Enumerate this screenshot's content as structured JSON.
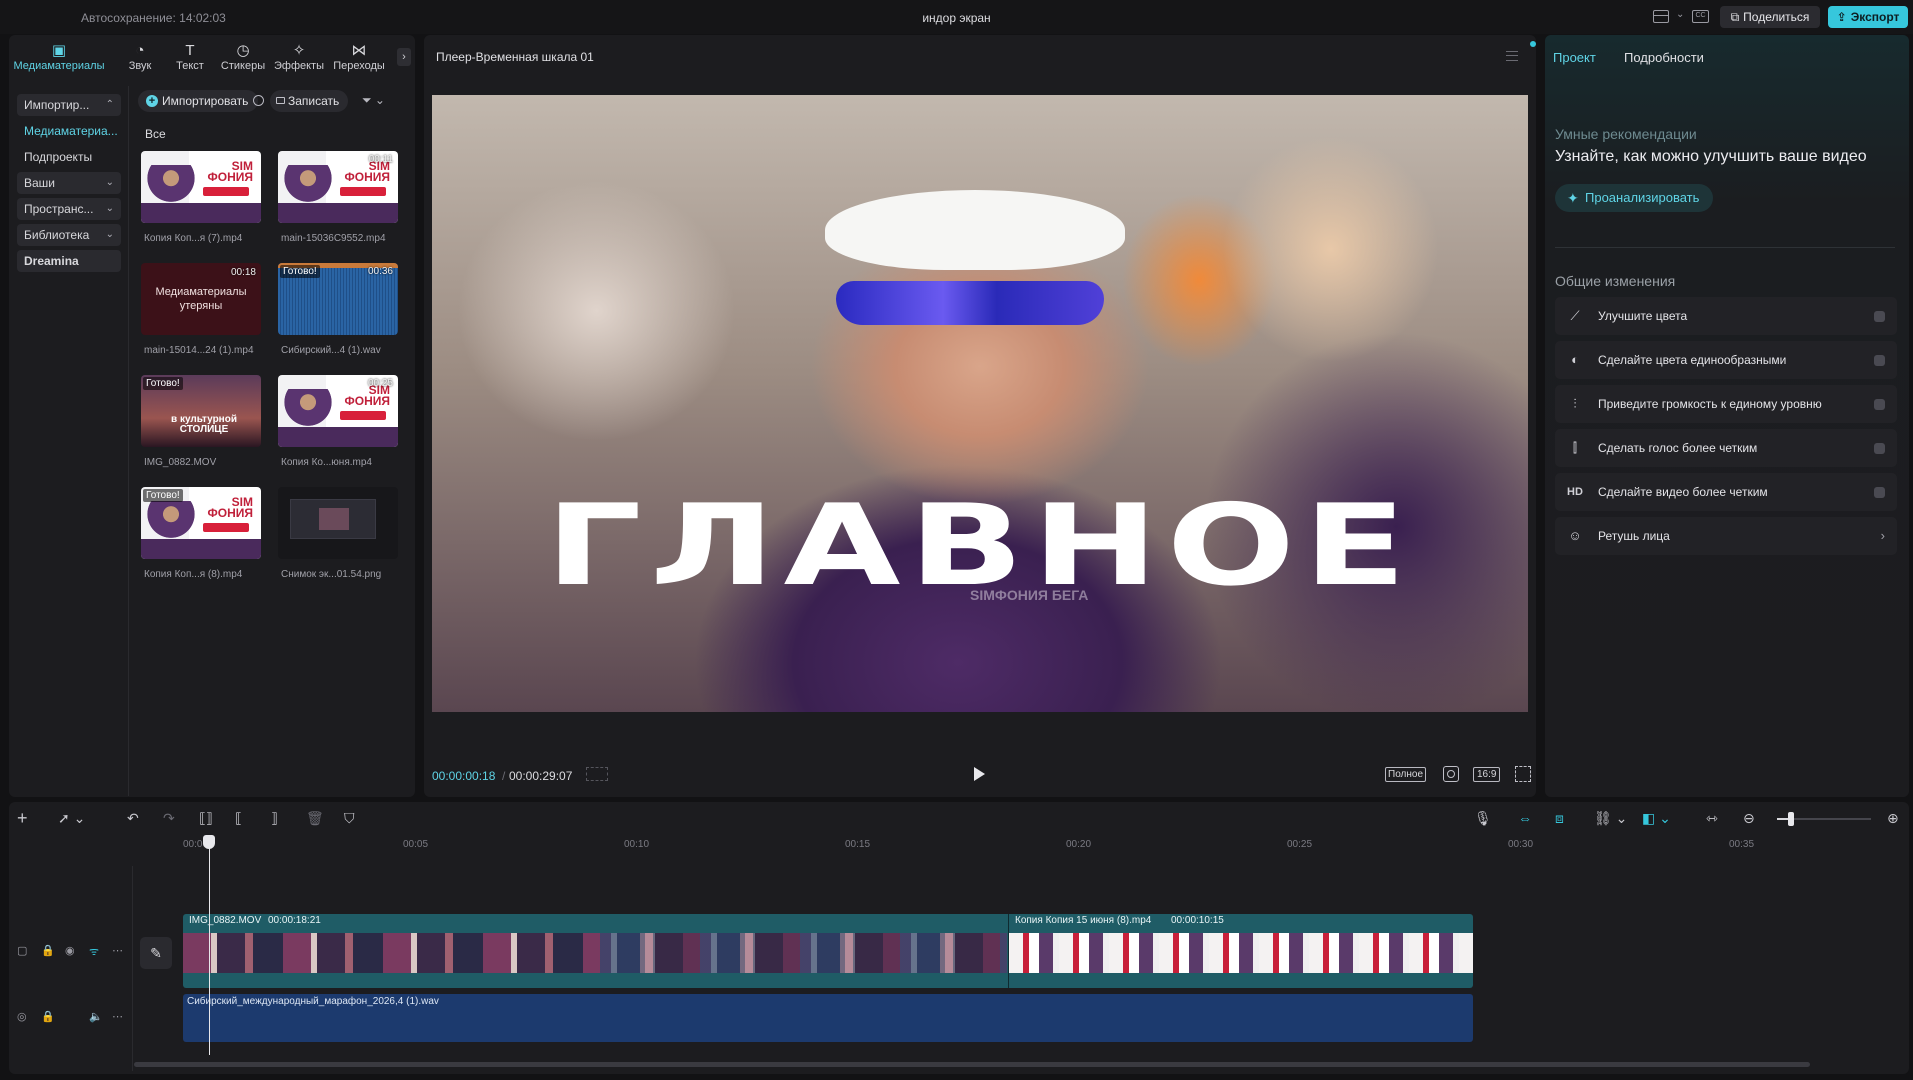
{
  "topbar": {
    "autosave": "Автосохранение: 14:02:03",
    "project_name": "индор экран",
    "share": "Поделиться",
    "export": "Экспорт"
  },
  "tool_tabs": [
    {
      "label": "Медиаматериалы",
      "icon": "media-icon"
    },
    {
      "label": "Звук",
      "icon": "audio-icon"
    },
    {
      "label": "Текст",
      "icon": "text-icon"
    },
    {
      "label": "Стикеры",
      "icon": "sticker-icon"
    },
    {
      "label": "Эффекты",
      "icon": "effects-icon"
    },
    {
      "label": "Переходы",
      "icon": "transitions-icon"
    }
  ],
  "side_nav": [
    {
      "label": "Импортир...",
      "type": "pill"
    },
    {
      "label": "Медиаматериа...",
      "type": "selected"
    },
    {
      "label": "Подпроекты",
      "type": "plain"
    },
    {
      "label": "Ваши",
      "type": "pill"
    },
    {
      "label": "Пространс...",
      "type": "pill"
    },
    {
      "label": "Библиотека",
      "type": "pill"
    },
    {
      "label": "Dreamina",
      "type": "pill"
    }
  ],
  "media_toolbar": {
    "import": "Импортировать",
    "record": "Записать",
    "filter_label": "Все"
  },
  "media_items": [
    {
      "name": "Копия Коп...я (7).mp4",
      "duration": "",
      "badge": "",
      "kind": "poster"
    },
    {
      "name": "main-15036C9552.mp4",
      "duration": "00:11",
      "badge": "",
      "kind": "poster"
    },
    {
      "name": "main-15014...24 (1).mp4",
      "duration": "00:18",
      "badge": "",
      "kind": "lost",
      "lost_text": "Медиаматериалы утеряны"
    },
    {
      "name": "Сибирский...4 (1).wav",
      "duration": "00:36",
      "badge": "Готово!",
      "kind": "wave"
    },
    {
      "name": "IMG_0882.MOV",
      "duration": "",
      "badge": "Готово!",
      "kind": "runner",
      "caption": "в культурной СТОЛИЦЕ"
    },
    {
      "name": "Копия Ко...юня.mp4",
      "duration": "00:25",
      "badge": "",
      "kind": "poster"
    },
    {
      "name": "Копия Коп...я (8).mp4",
      "duration": "",
      "badge": "Готово!",
      "kind": "poster"
    },
    {
      "name": "Снимок эк...01.54.png",
      "duration": "",
      "badge": "",
      "kind": "screen"
    }
  ],
  "player": {
    "title": "Плеер-Временная шкала 01",
    "headline": "ГЛАВНОЕ",
    "logo_text": "SIMФОНИЯ БЕГА",
    "time_current": "00:00:00:18",
    "time_total": "00:00:29:07",
    "full_label": "Полное",
    "ratio_label": "16:9"
  },
  "right_panel": {
    "tab_project": "Проект",
    "tab_details": "Подробности",
    "smart_title": "Умные рекомендации",
    "smart_desc": "Узнайте, как можно улучшить ваше видео",
    "analyze": "Проанализировать",
    "general_title": "Общие изменения",
    "options": [
      {
        "label": "Улучшите цвета",
        "icon": "magic-wand-icon",
        "control": "toggle"
      },
      {
        "label": "Сделайте цвета единообразными",
        "icon": "palette-icon",
        "control": "toggle"
      },
      {
        "label": "Приведите громкость к единому уровню",
        "icon": "sliders-icon",
        "control": "toggle"
      },
      {
        "label": "Сделать голос более четким",
        "icon": "voice-icon",
        "control": "toggle"
      },
      {
        "label": "Сделайте видео более четким",
        "icon": "hd-icon",
        "control": "toggle"
      },
      {
        "label": "Ретушь лица",
        "icon": "face-icon",
        "control": "arrow"
      }
    ]
  },
  "timeline": {
    "ticks": [
      "00:00",
      "00:05",
      "00:10",
      "00:15",
      "00:20",
      "00:25",
      "00:30",
      "00:35"
    ],
    "clip_a_name": "IMG_0882.MOV",
    "clip_a_duration": "00:00:18:21",
    "clip_b_name": "Копия Копия 15 июня (8).mp4",
    "clip_b_duration": "00:00:10:15",
    "audio_name": "Сибирский_международный_марафон_2026,4 (1).wav"
  },
  "colors": {
    "accent": "#36c7dc",
    "video_track": "#1f5c66",
    "audio_track": "#1c3a6e"
  }
}
